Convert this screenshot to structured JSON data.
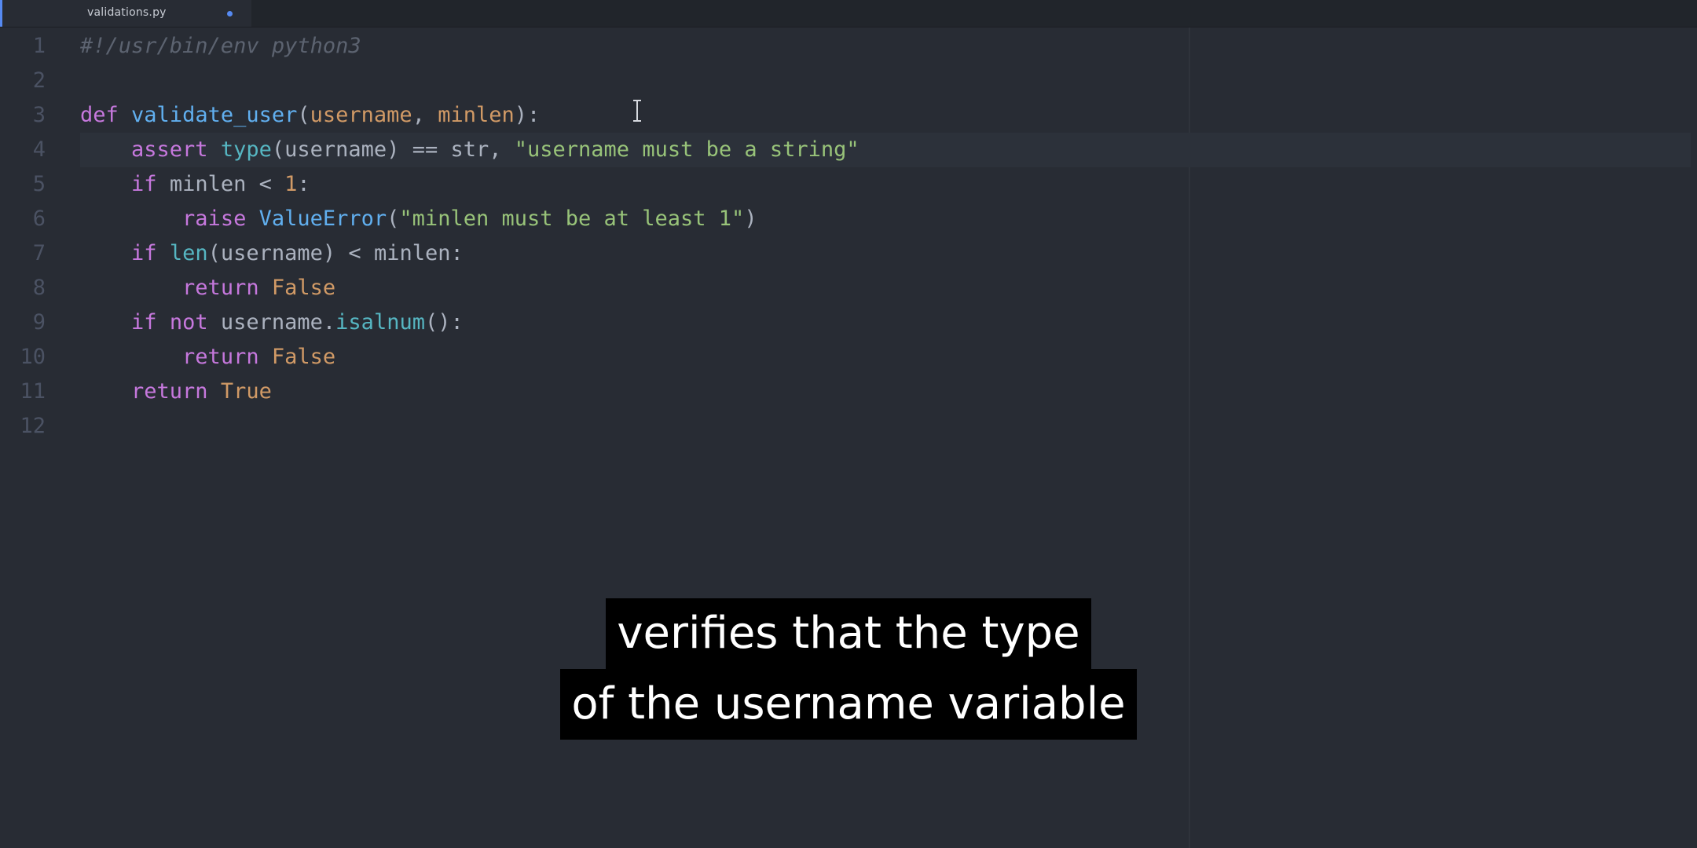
{
  "tab": {
    "title": "validations.py",
    "modified": true
  },
  "editor": {
    "lines": [
      {
        "num": "1",
        "tokens": [
          {
            "t": "#!/usr/bin/env python3",
            "k": "comment"
          }
        ]
      },
      {
        "num": "2",
        "tokens": []
      },
      {
        "num": "3",
        "tokens": [
          {
            "t": "def",
            "k": "keyword"
          },
          {
            "t": " ",
            "k": "punct"
          },
          {
            "t": "validate_user",
            "k": "function"
          },
          {
            "t": "(",
            "k": "punct"
          },
          {
            "t": "username",
            "k": "param"
          },
          {
            "t": ", ",
            "k": "punct"
          },
          {
            "t": "minlen",
            "k": "param"
          },
          {
            "t": "):",
            "k": "punct"
          }
        ]
      },
      {
        "num": "4",
        "cursor": true,
        "tokens": [
          {
            "t": "    ",
            "k": "punct"
          },
          {
            "t": "assert",
            "k": "keyword"
          },
          {
            "t": " ",
            "k": "punct"
          },
          {
            "t": "type",
            "k": "builtin"
          },
          {
            "t": "(",
            "k": "punct"
          },
          {
            "t": "username",
            "k": "ident"
          },
          {
            "t": ") == ",
            "k": "punct"
          },
          {
            "t": "str",
            "k": "ident"
          },
          {
            "t": ", ",
            "k": "punct"
          },
          {
            "t": "\"username must be a string\"",
            "k": "string"
          }
        ]
      },
      {
        "num": "5",
        "tokens": [
          {
            "t": "    ",
            "k": "punct"
          },
          {
            "t": "if",
            "k": "keyword"
          },
          {
            "t": " ",
            "k": "punct"
          },
          {
            "t": "minlen",
            "k": "ident"
          },
          {
            "t": " < ",
            "k": "punct"
          },
          {
            "t": "1",
            "k": "number"
          },
          {
            "t": ":",
            "k": "punct"
          }
        ]
      },
      {
        "num": "6",
        "tokens": [
          {
            "t": "        ",
            "k": "punct"
          },
          {
            "t": "raise",
            "k": "keyword"
          },
          {
            "t": " ",
            "k": "punct"
          },
          {
            "t": "ValueError",
            "k": "function"
          },
          {
            "t": "(",
            "k": "punct"
          },
          {
            "t": "\"minlen must be at least 1\"",
            "k": "string"
          },
          {
            "t": ")",
            "k": "punct"
          }
        ]
      },
      {
        "num": "7",
        "tokens": [
          {
            "t": "    ",
            "k": "punct"
          },
          {
            "t": "if",
            "k": "keyword"
          },
          {
            "t": " ",
            "k": "punct"
          },
          {
            "t": "len",
            "k": "builtin"
          },
          {
            "t": "(",
            "k": "punct"
          },
          {
            "t": "username",
            "k": "ident"
          },
          {
            "t": ") < ",
            "k": "punct"
          },
          {
            "t": "minlen",
            "k": "ident"
          },
          {
            "t": ":",
            "k": "punct"
          }
        ]
      },
      {
        "num": "8",
        "tokens": [
          {
            "t": "        ",
            "k": "punct"
          },
          {
            "t": "return",
            "k": "keyword"
          },
          {
            "t": " ",
            "k": "punct"
          },
          {
            "t": "False",
            "k": "constant"
          }
        ]
      },
      {
        "num": "9",
        "tokens": [
          {
            "t": "    ",
            "k": "punct"
          },
          {
            "t": "if",
            "k": "keyword"
          },
          {
            "t": " ",
            "k": "punct"
          },
          {
            "t": "not",
            "k": "keyword"
          },
          {
            "t": " ",
            "k": "punct"
          },
          {
            "t": "username",
            "k": "ident"
          },
          {
            "t": ".",
            "k": "punct"
          },
          {
            "t": "isalnum",
            "k": "builtin"
          },
          {
            "t": "():",
            "k": "punct"
          }
        ]
      },
      {
        "num": "10",
        "tokens": [
          {
            "t": "        ",
            "k": "punct"
          },
          {
            "t": "return",
            "k": "keyword"
          },
          {
            "t": " ",
            "k": "punct"
          },
          {
            "t": "False",
            "k": "constant"
          }
        ]
      },
      {
        "num": "11",
        "tokens": [
          {
            "t": "    ",
            "k": "punct"
          },
          {
            "t": "return",
            "k": "keyword"
          },
          {
            "t": " ",
            "k": "punct"
          },
          {
            "t": "True",
            "k": "constant"
          }
        ]
      },
      {
        "num": "12",
        "tokens": []
      }
    ]
  },
  "caption": {
    "line1": "verifies that the type",
    "line2": "of the username variable"
  },
  "colors": {
    "background": "#282c34",
    "keyword": "#c678dd",
    "function": "#61afef",
    "string": "#98c379",
    "constant": "#d19a66",
    "comment": "#5c6370"
  },
  "icons": {
    "cursor": "text-cursor-ibeam-icon",
    "modified": "modified-dot-icon"
  }
}
